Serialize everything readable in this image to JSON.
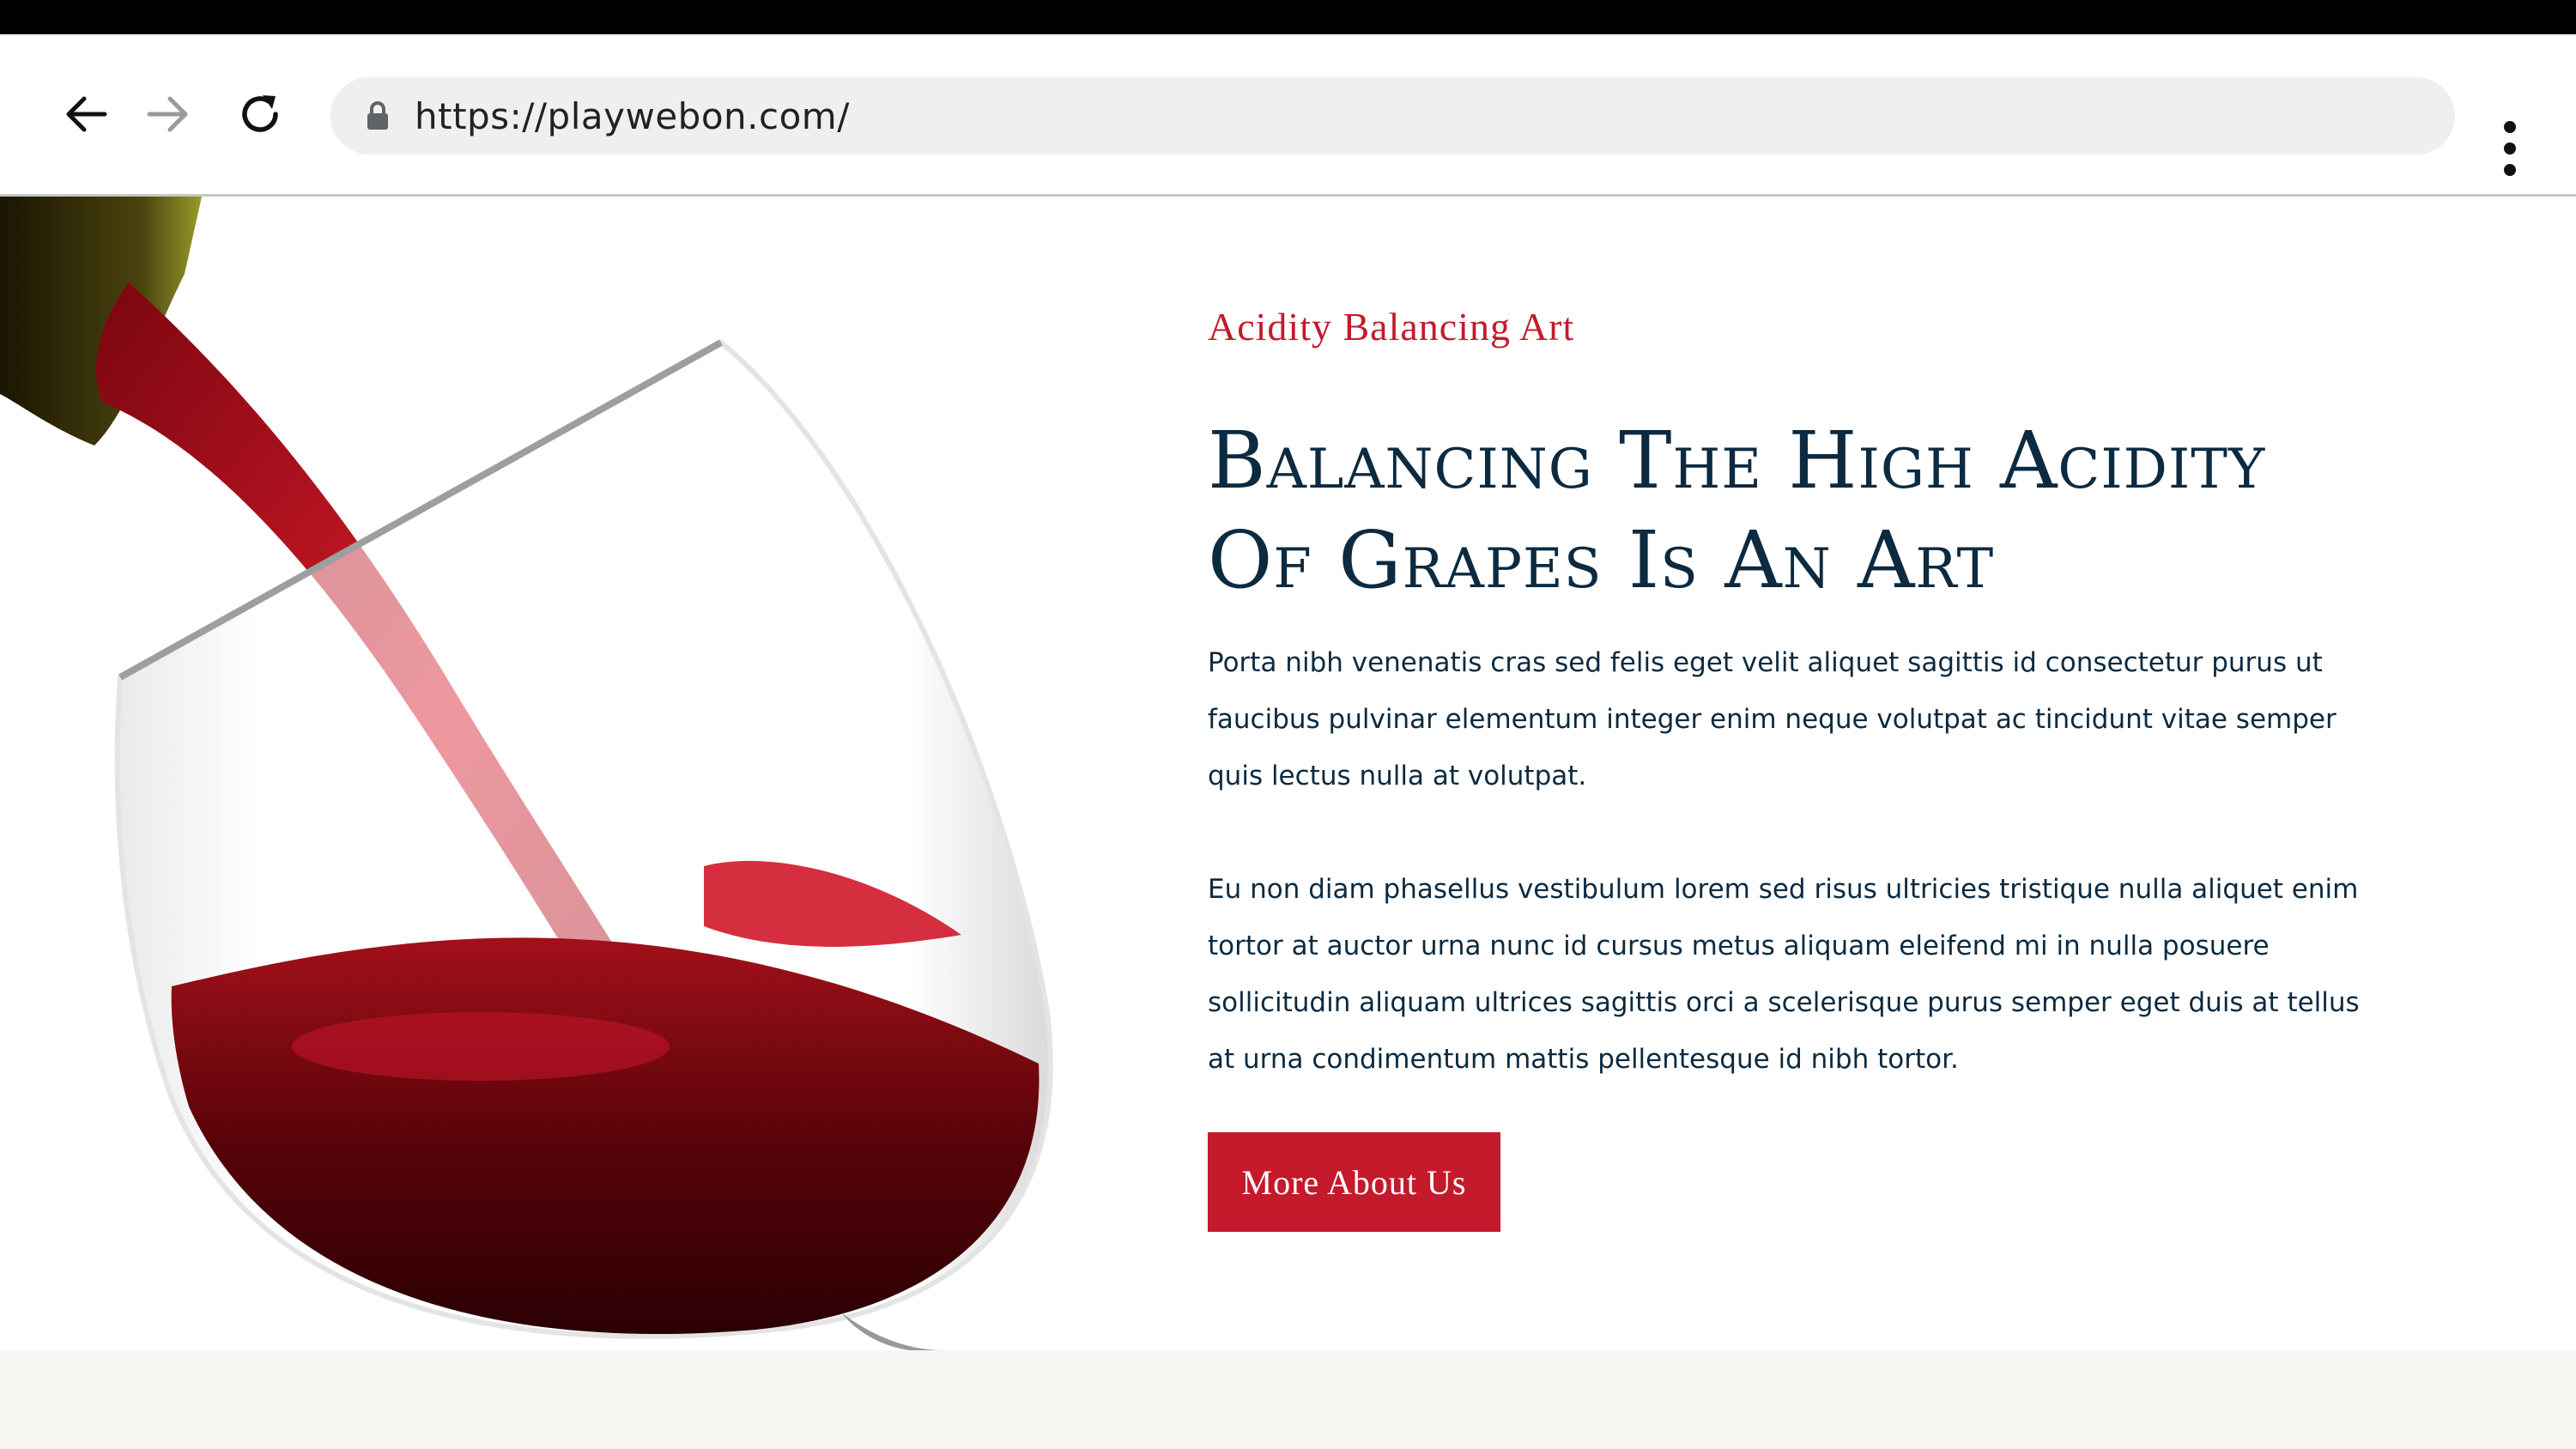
{
  "browser": {
    "url": "https://playwebon.com/"
  },
  "hero": {
    "eyebrow": "Acidity Balancing Art",
    "headline_line1": "Balancing The High Acidity",
    "headline_line2": "Of Grapes Is An Art",
    "paragraph1": "Porta nibh venenatis cras sed felis eget velit aliquet sagittis id consectetur purus ut faucibus pulvinar elementum integer enim neque volutpat ac tincidunt vitae semper quis lectus nulla at volutpat.",
    "paragraph2": "Eu non diam phasellus vestibulum lorem sed risus ultricies tristique nulla aliquet enim tortor at auctor urna nunc id cursus metus aliquam eleifend mi in nulla posuere sollicitudin aliquam ultrices sagittis orci a scelerisque purus semper eget duis at tellus at urna condimentum mattis pellentesque id nibh tortor.",
    "cta_label": "More About Us"
  },
  "colors": {
    "accent": "#c41a2b",
    "heading": "#0c2a40",
    "footer_bg": "#f8f6f3"
  },
  "icons": {
    "back": "back-arrow-icon",
    "forward": "forward-arrow-icon",
    "reload": "reload-icon",
    "lock": "lock-icon",
    "menu": "more-vert-icon"
  }
}
